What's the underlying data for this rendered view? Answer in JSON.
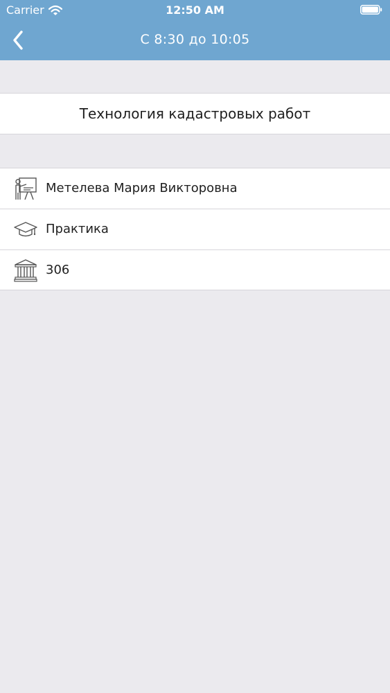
{
  "status_bar": {
    "carrier": "Carrier",
    "time": "12:50 AM",
    "icons": [
      "wifi-icon",
      "battery-icon"
    ]
  },
  "nav": {
    "back_icon": "chevron-left-icon",
    "title": "С 8:30 до 10:05"
  },
  "subject": {
    "title": "Технология кадастровых работ"
  },
  "details": [
    {
      "icon": "teacher-icon",
      "label": "Метелева Мария Викторовна"
    },
    {
      "icon": "graduation-cap-icon",
      "label": "Практика"
    },
    {
      "icon": "building-icon",
      "label": "306"
    }
  ],
  "colors": {
    "header": "#6fa6d0",
    "background": "#ebeaee",
    "card": "#ffffff",
    "icon_stroke": "#555555"
  }
}
